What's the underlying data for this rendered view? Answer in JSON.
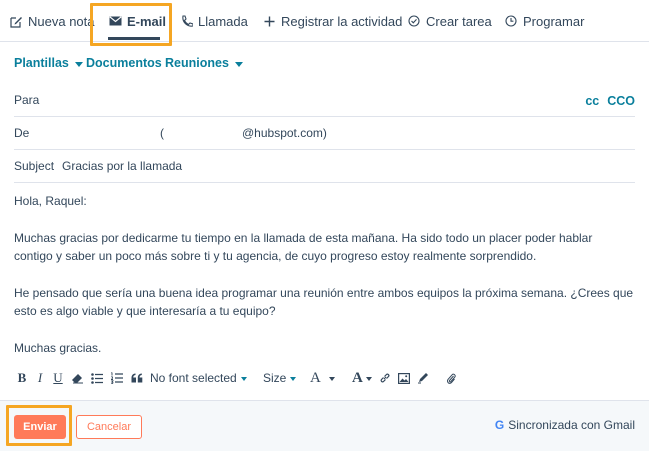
{
  "tabs": [
    {
      "label": "Nueva nota",
      "icon": "edit-icon"
    },
    {
      "label": "E-mail",
      "icon": "envelope-icon",
      "active": true
    },
    {
      "label": "Llamada",
      "icon": "phone-icon"
    },
    {
      "label": "Registrar la actividad",
      "icon": "plus-icon"
    },
    {
      "label": "Crear tarea",
      "icon": "check-circle-icon"
    },
    {
      "label": "Programar",
      "icon": "clock-icon"
    }
  ],
  "subbar": {
    "templates": "Plantillas",
    "documents": "Documentos",
    "meetings": "Reuniones"
  },
  "fields": {
    "to_label": "Para",
    "cc_label": "cc",
    "bcc_label": "CCO",
    "from_label": "De",
    "from_open_paren": "(",
    "from_email_suffix": "@hubspot.com)",
    "subject_label": "Subject",
    "subject_value": "Gracias por la llamada"
  },
  "body": {
    "greeting": "Hola, Raquel:",
    "paragraph1": "Muchas gracias por dedicarme tu tiempo en la llamada de esta mañana. Ha sido todo un placer poder hablar contigo y saber un poco más sobre ti y tu agencia, de cuyo progreso estoy realmente sorprendido.",
    "paragraph2": "He pensado que sería una buena idea programar una reunión entre ambos equipos la próxima semana. ¿Crees que esto es algo viable y que interesaría a tu equipo?",
    "closing": "Muchas gracias."
  },
  "toolbar": {
    "bold": "B",
    "italic": "I",
    "underline": "U",
    "font_select": "No font selected",
    "size_select": "Size",
    "font_color": "A",
    "highlight": "A"
  },
  "footer": {
    "send": "Enviar",
    "cancel": "Cancelar",
    "sync_g": "G",
    "sync_text": "Sincronizada con Gmail"
  },
  "colors": {
    "accent": "#ff7a59",
    "link": "#0a7f9c",
    "text": "#33475b",
    "highlight_box": "#f5a623"
  }
}
